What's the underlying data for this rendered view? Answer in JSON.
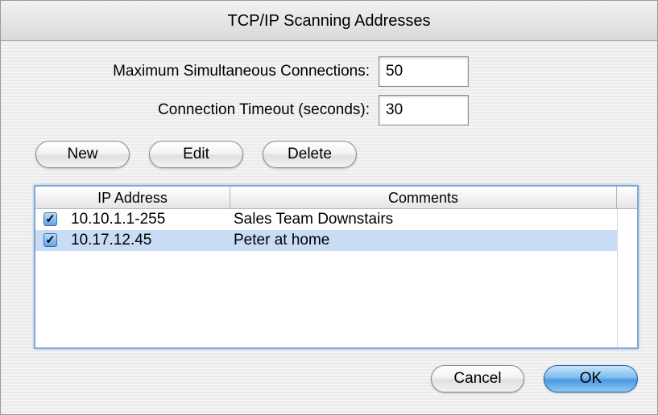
{
  "window": {
    "title": "TCP/IP Scanning Addresses"
  },
  "settings": {
    "max_connections_label": "Maximum Simultaneous Connections:",
    "max_connections_value": "50",
    "timeout_label": "Connection Timeout (seconds):",
    "timeout_value": "30"
  },
  "toolbar": {
    "new_label": "New",
    "edit_label": "Edit",
    "delete_label": "Delete"
  },
  "table": {
    "columns": [
      "IP Address",
      "Comments"
    ],
    "rows": [
      {
        "checked": true,
        "ip": "10.10.1.1-255",
        "comment": "Sales Team Downstairs",
        "selected": false
      },
      {
        "checked": true,
        "ip": "10.17.12.45",
        "comment": "Peter at home",
        "selected": true
      }
    ],
    "checkmark_glyph": "✓"
  },
  "footer": {
    "cancel_label": "Cancel",
    "ok_label": "OK"
  },
  "colors": {
    "selection": "#c8dcf6",
    "default_button": "#4a98e0",
    "table_focus_ring": "#7ea8d6"
  }
}
